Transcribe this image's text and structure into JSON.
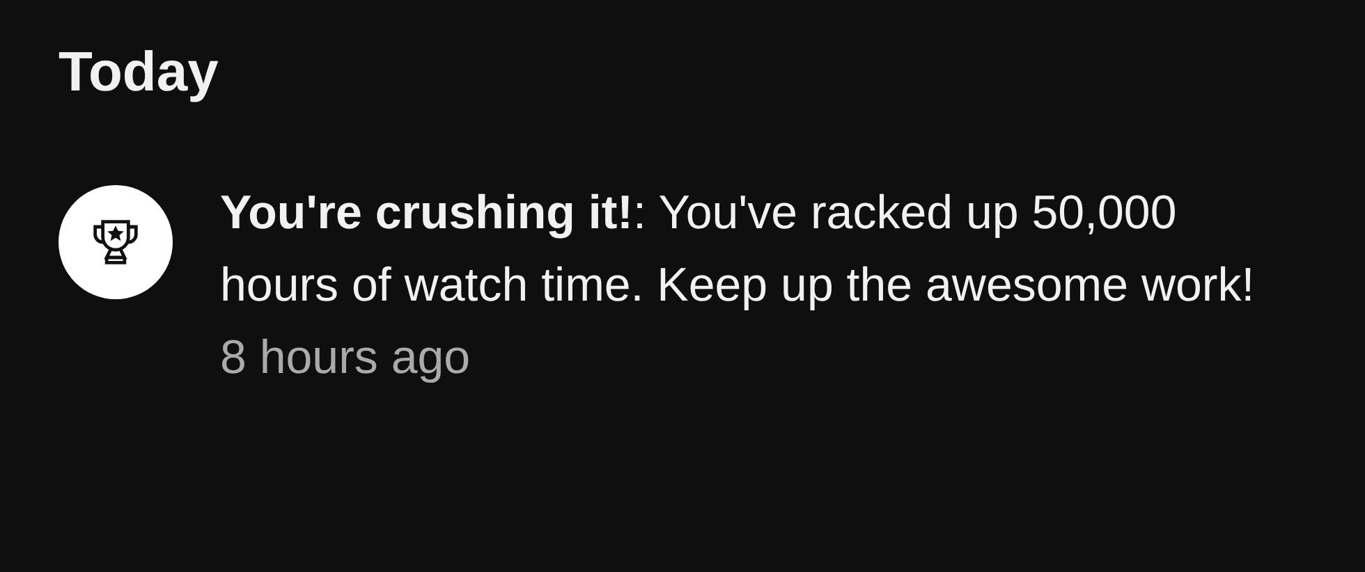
{
  "section_title": "Today",
  "notifications": [
    {
      "kind": "achievement",
      "message": "**You're crushing it!**: You've racked up 50,000 hours of watch time. Keep up the awesome work!",
      "time": "8 hours ago"
    }
  ]
}
